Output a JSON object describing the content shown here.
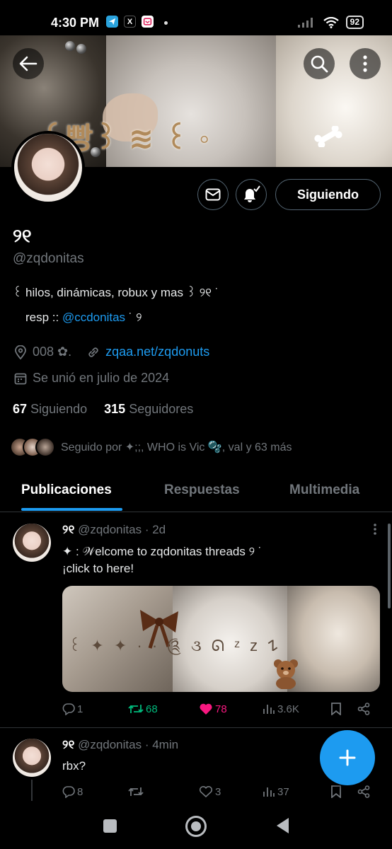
{
  "status_bar": {
    "time": "4:30 PM",
    "battery": "92",
    "apps": [
      "telegram-icon",
      "x-icon",
      "app-icon"
    ],
    "icons": [
      "signal-icon",
      "wifi-icon",
      "battery-icon"
    ]
  },
  "banner": {
    "text": "꒰빵꒱ ≋ ꒰ ◦"
  },
  "profile": {
    "name": "୨୧",
    "handle": "@zqdonitas",
    "follow_label": "Siguiendo",
    "bio_line1": "꒰  hilos, dinámicas, robux  y mas  ꒱                                ୨୧  ˙",
    "bio_line2_prefix": "resp :: ",
    "bio_line2_link": "@ccdonitas",
    "bio_line2_suffix": " ˙ ୨",
    "location": "008 ✿.",
    "website": "zqaa.net/zqdonuts",
    "joined": "Se unió en julio de 2024",
    "following_count": "67",
    "following_label": "Siguiendo",
    "followers_count": "315",
    "followers_label": "Seguidores",
    "followed_by": "Seguido por ✦;;, WHO is Vic 🫧, val y 63 más"
  },
  "tabs": [
    {
      "label": "Publicaciones",
      "active": true
    },
    {
      "label": "Respuestas",
      "active": false
    },
    {
      "label": "Multimedia",
      "active": false
    }
  ],
  "posts": [
    {
      "name": "୨୧",
      "handle": "@zqdonitas",
      "time": "· 2d",
      "text_line1": "✦  :  𝒲elcome to zqdonitas threads ୨ ˙",
      "text_line2": "¡click to here!",
      "media_text": "꒰  ✦  ✦ · · ༊ ૩ ᘏ ᶻ z 𐰁",
      "replies": "1",
      "reposts": "68",
      "likes": "78",
      "views": "3.6K"
    },
    {
      "name": "୨୧",
      "handle": "@zqdonitas",
      "time": "· 4min",
      "text_line1": "rbx?",
      "replies": "8",
      "reposts": "",
      "likes": "3",
      "views": "37"
    }
  ],
  "colors": {
    "accent": "#1d9bf0",
    "repost_active": "#00ba7c",
    "like_active": "#f91880",
    "muted": "#71767b"
  }
}
